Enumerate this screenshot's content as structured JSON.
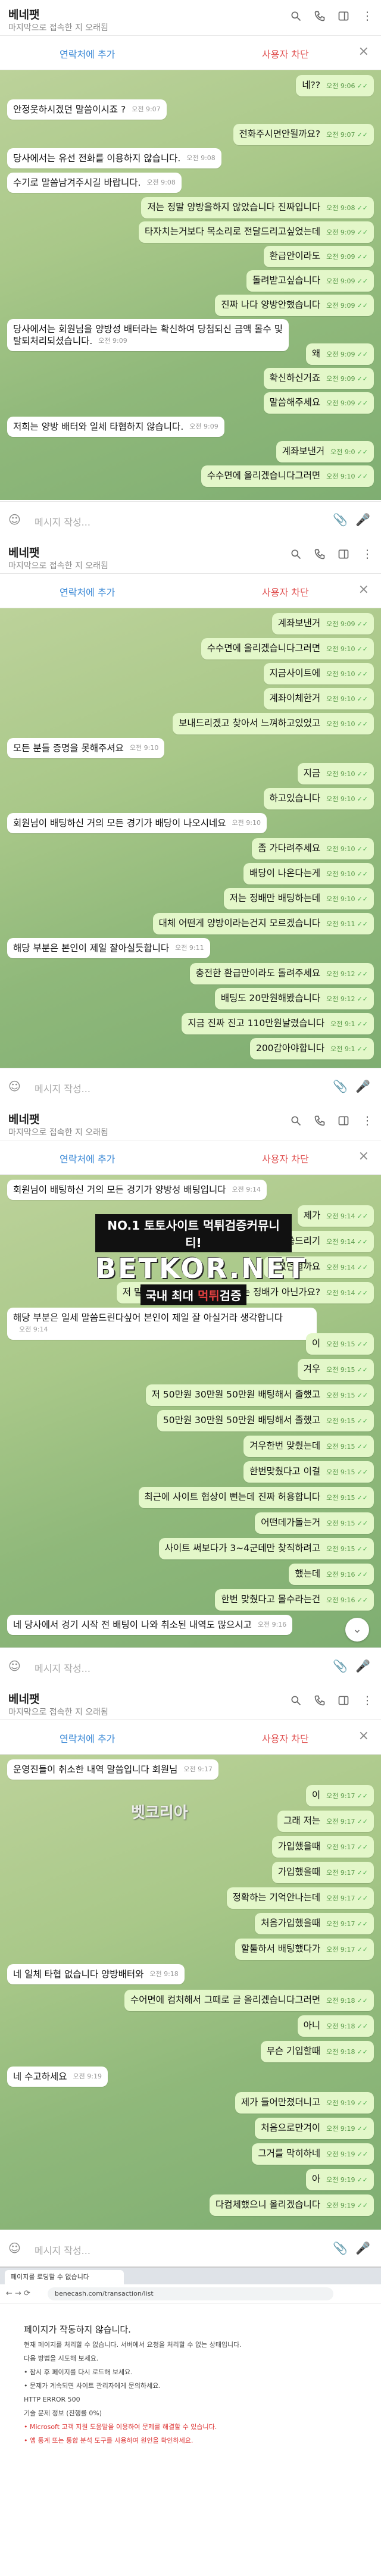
{
  "header": {
    "name": "베네팻",
    "subtitle": "마지막으로 접속한 지 오래됨"
  },
  "actions": {
    "add_contact": "연락처에 추가",
    "block_user": "사용자 차단",
    "close": "×"
  },
  "input": {
    "placeholder": "메시지 작성..."
  },
  "colors": {
    "out_bubble": "#e3f7c9",
    "in_bubble": "#ffffff",
    "accent": "#3a88d6",
    "danger": "#e05050"
  },
  "icons": [
    "search-icon",
    "phone-icon",
    "columns-icon",
    "more-icon",
    "emoji-icon",
    "attach-icon",
    "mic-icon"
  ],
  "panels": [
    {
      "messages": [
        {
          "dir": "out",
          "text": "네??",
          "time": "오전 9:06"
        },
        {
          "dir": "in",
          "text": "안정웃하시겠던 말씀이시죠 ?",
          "time": "오전 9:07"
        },
        {
          "dir": "out",
          "text": "전화주시면안될까요?",
          "time": "오전 9:07"
        },
        {
          "dir": "in",
          "text": "당사에서는 유선 전화를 이용하지 않습니다.",
          "time": "오전 9:08"
        },
        {
          "dir": "in",
          "text": "수기로 말씀남겨주시길 바랍니다.",
          "time": "오전 9:08"
        },
        {
          "dir": "out",
          "text": "저는 정말 양방을하지 않았습니다 진짜입니다",
          "time": "오전 9:08"
        },
        {
          "dir": "out",
          "text": "타자치는거보다 목소리로 전달드리고싶었는데",
          "time": "오전 9:09"
        },
        {
          "dir": "out",
          "text": "환급안이라도",
          "time": "오전 9:09"
        },
        {
          "dir": "out",
          "text": "돌려받고싶습니다",
          "time": "오전 9:09"
        },
        {
          "dir": "out",
          "text": "진짜 나다 양방안했습니다",
          "time": "오전 9:09"
        },
        {
          "dir": "in",
          "text": "당사에서는 회원님을 양방성 배터라는 확신하여 당첨되신 금액 몰수 및\n탈퇴처리되셨습니다.",
          "time": "오전 9:09"
        },
        {
          "dir": "out",
          "text": "왜",
          "time": "오전 9:09"
        },
        {
          "dir": "out",
          "text": "확신하신거죠",
          "time": "오전 9:09"
        },
        {
          "dir": "out",
          "text": "말씀해주세요",
          "time": "오전 9:09"
        },
        {
          "dir": "in",
          "text": "저희는 양방 배터와 일체 타협하지 않습니다.",
          "time": "오전 9:09"
        },
        {
          "dir": "out",
          "text": "계좌보낸거",
          "time": "오전 9:0"
        },
        {
          "dir": "out",
          "text": "수수면에 올리겠습니다그러면",
          "time": "오전 9:10"
        }
      ]
    },
    {
      "messages": [
        {
          "dir": "out",
          "text": "계좌보낸거",
          "time": "오전 9:09"
        },
        {
          "dir": "out",
          "text": "수수면에 올리겠습니다그러면",
          "time": "오전 9:10"
        },
        {
          "dir": "out",
          "text": "지금사이트에",
          "time": "오전 9:10"
        },
        {
          "dir": "out",
          "text": "계좌이체한거",
          "time": "오전 9:10"
        },
        {
          "dir": "out",
          "text": "보내드리겠고 찾아서 느껴하고있었고",
          "time": "오전 9:10"
        },
        {
          "dir": "in",
          "text": "모든 분들 증명을 못해주셔요",
          "time": "오전 9:10"
        },
        {
          "dir": "out",
          "text": "지금",
          "time": "오전 9:10"
        },
        {
          "dir": "out",
          "text": "하고있습니다",
          "time": "오전 9:10"
        },
        {
          "dir": "in",
          "text": "회원님이 배팅하신 거의 모든 경기가 배당이 나오시네요",
          "time": "오전 9:10"
        },
        {
          "dir": "out",
          "text": "좀 가다려주세요",
          "time": "오전 9:10"
        },
        {
          "dir": "out",
          "text": "배당이 나온다는게",
          "time": "오전 9:10"
        },
        {
          "dir": "out",
          "text": "저는 정배만 배팅하는데",
          "time": "오전 9:10"
        },
        {
          "dir": "out",
          "text": "대체 어떤게 양방이라는건지 모르겠습니다",
          "time": "오전 9:11"
        },
        {
          "dir": "in",
          "text": "해당 부분은 본인이 제일 잘아실듯합니다",
          "time": "오전 9:11"
        },
        {
          "dir": "out",
          "text": "충전한 환급만이라도 돌려주세요",
          "time": "오전 9:12"
        },
        {
          "dir": "out",
          "text": "배팅도 20만원해봤습니다",
          "time": "오전 9:12"
        },
        {
          "dir": "out",
          "text": "지금 진짜 진고 110만원날렸습니다",
          "time": "오전 9:1"
        },
        {
          "dir": "out",
          "text": "200감아야합니다",
          "time": "오전 9:1"
        }
      ]
    },
    {
      "messages": [
        {
          "dir": "in",
          "text": "회원님이 배팅하신 거의 모든 경기가 양방성 배팅입니다",
          "time": "오전 9:14"
        },
        {
          "dir": "out",
          "text": "제가",
          "time": "오전 9:14"
        },
        {
          "dir": "out",
          "text": "말씀드리기",
          "time": "오전 9:14"
        },
        {
          "dir": "out",
          "text": "하셨던걸까요",
          "time": "오전 9:14"
        },
        {
          "dir": "out",
          "text": "저 말씀해주세요 정말 양방이라는 정배가 아닌가요?",
          "time": "오전 9:14"
        },
        {
          "dir": "in",
          "text": "해당 부분은 일세 말씀드린다싶어 본인이 제일 잘 아실거라 생각합니다",
          "time": "오전 9:14"
        },
        {
          "dir": "out",
          "text": "이",
          "time": "오전 9:15"
        },
        {
          "dir": "out",
          "text": "겨우",
          "time": "오전 9:15"
        },
        {
          "dir": "out",
          "text": "저 50만원 30만원 50만원 배팅해서 졸했고",
          "time": "오전 9:15"
        },
        {
          "dir": "out",
          "text": "50만원 30만원 50만원 배팅해서 졸했고",
          "time": "오전 9:15"
        },
        {
          "dir": "out",
          "text": "겨우한번 맞췄는데",
          "time": "오전 9:15"
        },
        {
          "dir": "out",
          "text": "한번맞췄다고 이걸",
          "time": "오전 9:15"
        },
        {
          "dir": "out",
          "text": "최근에 사이트 협상이 뻔는데 진짜 허용합니다",
          "time": "오전 9:15"
        },
        {
          "dir": "out",
          "text": "어떤데가돌는거",
          "time": "오전 9:15"
        },
        {
          "dir": "out",
          "text": "사이트 써보다가 3~4군데만 찾직하려고",
          "time": "오전 9:15"
        },
        {
          "dir": "out",
          "text": "했는데",
          "time": "오전 9:16"
        },
        {
          "dir": "out",
          "text": "한번 맞췄다고 몰수라는건",
          "time": "오전 9:16"
        },
        {
          "dir": "in",
          "text": "네 당사에서 경기 시작 전 배팅이 나와 취소된 내역도 많으시고",
          "time": "오전 9:16"
        }
      ]
    },
    {
      "messages": [
        {
          "dir": "in",
          "text": "운영진들이 취소한 내역 말씀입니다 회원님",
          "time": "오전 9:17"
        },
        {
          "dir": "out",
          "text": "이",
          "time": "오전 9:17"
        },
        {
          "dir": "out",
          "text": "그래 저는",
          "time": "오전 9:17"
        },
        {
          "dir": "out",
          "text": "가입했을때",
          "time": "오전 9:17"
        },
        {
          "dir": "out",
          "text": "가입했을때",
          "time": "오전 9:17"
        },
        {
          "dir": "out",
          "text": "정확하는 기억안나는데",
          "time": "오전 9:17"
        },
        {
          "dir": "out",
          "text": "처음가입했을때",
          "time": "오전 9:17"
        },
        {
          "dir": "out",
          "text": "할툴하서 배팅했다가",
          "time": "오전 9:17"
        },
        {
          "dir": "in",
          "text": "네 일체 타협 없습니다 양방배터와",
          "time": "오전 9:18"
        },
        {
          "dir": "out",
          "text": "수어면에 컴처해서 그때로 글 올리겠습니다그러면",
          "time": "오전 9:18"
        },
        {
          "dir": "out",
          "text": "아니",
          "time": "오전 9:18"
        },
        {
          "dir": "out",
          "text": "무슨 기입할때",
          "time": "오전 9:18"
        },
        {
          "dir": "in",
          "text": "네 수고하세요",
          "time": "오전 9:19"
        },
        {
          "dir": "out",
          "text": "제가 들어만졌더니고",
          "time": "오전 9:19"
        },
        {
          "dir": "out",
          "text": "처음으로만겨이",
          "time": "오전 9:19"
        },
        {
          "dir": "out",
          "text": "그거를 막히하네",
          "time": "오전 9:19"
        },
        {
          "dir": "out",
          "text": "아",
          "time": "오전 9:19"
        },
        {
          "dir": "out",
          "text": "다컴체했으니 올리겠습니다",
          "time": "오전 9:19"
        }
      ]
    }
  ],
  "watermark": {
    "line1": "NO.1 토토사이트 먹튀검증커뮤니티!",
    "line2": "BETKOR.NET",
    "line3a": "국내 최대 ",
    "line3b": "먹튀",
    "line3c": "검증",
    "line4a": "벳코리아",
    "line4b": "벳코리아"
  },
  "browser": {
    "tab": "페이지를 로딩할 수 없습니다",
    "url": "benecash.com/transaction/list",
    "nav": "← → ⟳",
    "title": "페이지가 작동하지 않습니다.",
    "lines": [
      "현재 페이지를 처리할 수 없습니다. 서버에서 요청을 처리할 수 없는 상태입니다.",
      "다음 방법을 시도해 보세요.",
      "• 잠시 후 페이지를 다시 로드해 보세요.",
      "• 문제가 계속되면 사이트 관리자에게 문의하세요.",
      "HTTP ERROR 500",
      "기술 문제 정보 (진행률 0%)",
      "• Microsoft 고객 지원 도움말을 이용하여 문제를 해결할 수 있습니다.",
      "• 앱 통계 또는 통합 분석 도구를 사용하여 원인을 확인하세요."
    ]
  }
}
